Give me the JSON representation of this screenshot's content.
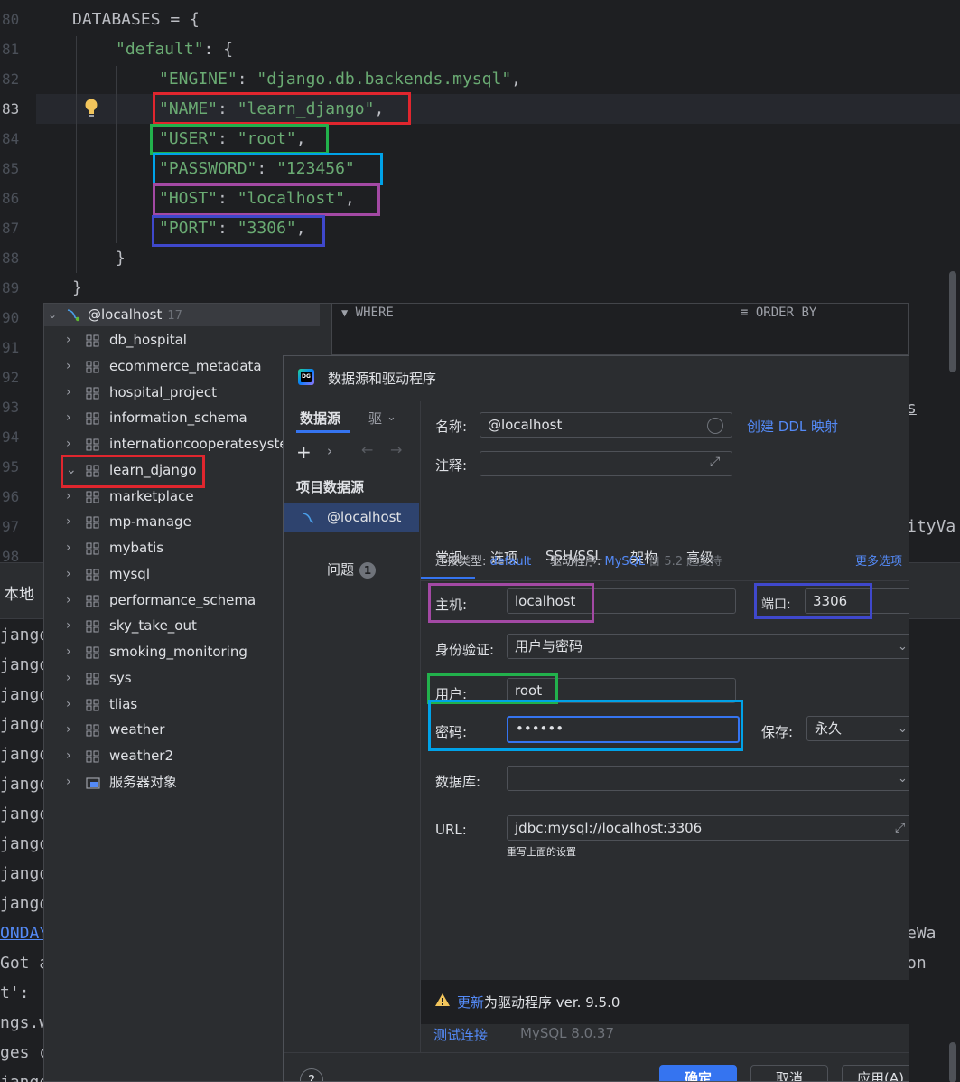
{
  "editor": {
    "line_numbers": [
      "80",
      "81",
      "82",
      "83",
      "84",
      "85",
      "86",
      "87",
      "88",
      "89",
      "90",
      "91",
      "92",
      "93",
      "94",
      "95",
      "96",
      "97",
      "98"
    ],
    "code": {
      "l80": "DATABASES = {",
      "l81_key": "\"default\"",
      "l81_rest": ": {",
      "l82_key": "\"ENGINE\"",
      "l82_sep": ": ",
      "l82_val": "\"django.db.backends.mysql\"",
      "l82_end": ",",
      "l83_key": "\"NAME\"",
      "l83_sep": ": ",
      "l83_val": "\"learn_django\"",
      "l83_end": ",",
      "l84_key": "\"USER\"",
      "l84_sep": ": ",
      "l84_val": "\"root\"",
      "l84_end": ",",
      "l85_key": "\"PASSWORD\"",
      "l85_sep": ": ",
      "l85_val": "\"123456\"",
      "l86_key": "\"HOST\"",
      "l86_sep": ": ",
      "l86_val": "\"localhost\"",
      "l86_end": ",",
      "l87_key": "\"PORT\"",
      "l87_sep": ": ",
      "l87_val": "\"3306\"",
      "l87_end": ",",
      "l88": "}",
      "l89": "}"
    },
    "right_fragments": {
      "f1": "s",
      "f2": "ityVa"
    }
  },
  "run_panel": {
    "tab_label": "本地",
    "log_lines": [
      "jango",
      "jango",
      "jango",
      "jango",
      "jango",
      "jango",
      "jango",
      "jango",
      "jango",
      "jango"
    ],
    "log_link_line": "ONDAY",
    "log_tail": [
      "Got a",
      "t':",
      "ngs.w",
      "ges c",
      "jango"
    ],
    "right_tail": [
      "eWa",
      "on"
    ]
  },
  "db_tree": {
    "root": {
      "label": "@localhost",
      "count": "17"
    },
    "items": [
      {
        "label": "db_hospital"
      },
      {
        "label": "ecommerce_metadata"
      },
      {
        "label": "hospital_project"
      },
      {
        "label": "information_schema"
      },
      {
        "label": "internationcooperatesyste"
      },
      {
        "label": "learn_django"
      },
      {
        "label": "marketplace"
      },
      {
        "label": "mp-manage"
      },
      {
        "label": "mybatis"
      },
      {
        "label": "mysql"
      },
      {
        "label": "performance_schema"
      },
      {
        "label": "sky_take_out"
      },
      {
        "label": "smoking_monitoring"
      },
      {
        "label": "sys"
      },
      {
        "label": "tlias"
      },
      {
        "label": "weather"
      },
      {
        "label": "weather2"
      },
      {
        "label": "服务器对象"
      }
    ]
  },
  "results_header": {
    "where": "WHERE",
    "order_by": "ORDER BY"
  },
  "dialog": {
    "title": "数据源和驱动程序",
    "logo_text": "DG",
    "left": {
      "tab_datasource": "数据源",
      "tab_driver": "驱",
      "section": "项目数据源",
      "selected": "@localhost",
      "problems": "问题",
      "problems_count": "1"
    },
    "name_label": "名称:",
    "name_value": "@localhost",
    "create_ddl": "创建 DDL 映射",
    "comment_label": "注释:",
    "tabs": [
      "常规",
      "选项",
      "SSH/SSL",
      "架构",
      "高级"
    ],
    "conn_type_label": "连接类型:",
    "conn_type_value": "default",
    "driver_label": "驱动程序:",
    "driver_value": "MySQL",
    "driver_note": "自 5.2 起支持",
    "more_options": "更多选项",
    "host_label": "主机:",
    "host_value": "localhost",
    "port_label": "端口:",
    "port_value": "3306",
    "auth_label": "身份验证:",
    "auth_value": "用户与密码",
    "user_label": "用户:",
    "user_value": "root",
    "password_label": "密码:",
    "password_value": "••••••",
    "save_label": "保存:",
    "save_value": "永久",
    "database_label": "数据库:",
    "database_value": "",
    "url_label": "URL:",
    "url_value": "jdbc:mysql://localhost:3306",
    "url_note": "重写上面的设置",
    "update_link": "更新",
    "update_text": "为驱动程序 ver. 9.5.0",
    "test_connection": "测试连接",
    "mysql_version": "MySQL 8.0.37",
    "help": "?",
    "ok": "确定",
    "cancel": "取消",
    "apply": "应用(A)"
  },
  "colors": {
    "annotation_red": "#e0262e",
    "annotation_green": "#22b14c",
    "annotation_cyan": "#00a2e8",
    "annotation_purple": "#a349a4",
    "annotation_blue": "#3f48cc",
    "accent": "#3574f0",
    "string": "#6aab73"
  }
}
